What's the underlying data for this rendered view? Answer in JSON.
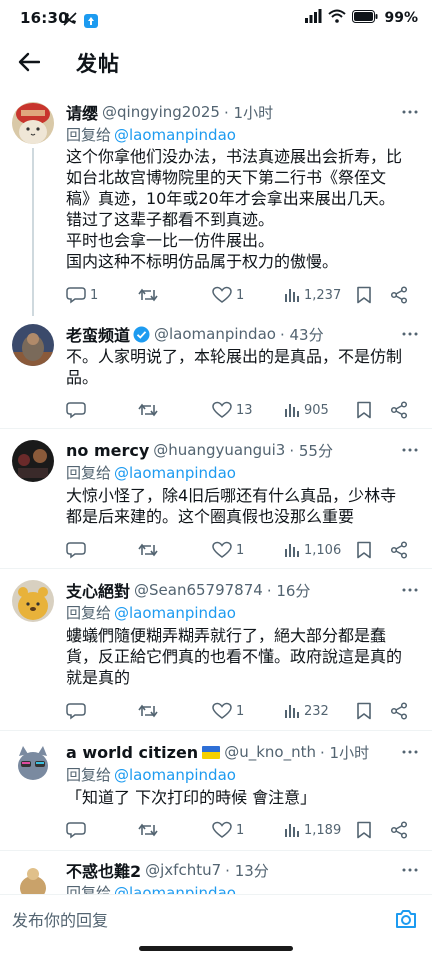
{
  "status_bar": {
    "time": "16:30",
    "battery": "99%"
  },
  "header": {
    "title": "发帖"
  },
  "replies": [
    {
      "name": "请缨",
      "handle": "@qingying2025",
      "time": "· 1小时",
      "reply_label": "回复给",
      "mention": "@laomanpindao",
      "lines": [
        "这个你拿他们没办法，书法真迹展出会折寿，比",
        "如台北故宫博物院里的天下第二行书《祭侄文",
        "稿》真迹，10年或20年才会拿出来展出几天。",
        "错过了这辈子都看不到真迹。",
        "平时也会拿一比一仿件展出。",
        "国内这种不标明仿品属于权力的傲慢。"
      ],
      "replies_count": "1",
      "retweets_count": "",
      "likes_count": "1",
      "views_count": "1,237"
    },
    {
      "name": "老蛮频道",
      "handle": "@laomanpindao",
      "time": "· 43分",
      "reply_label": "",
      "mention": "",
      "lines": [
        "不。人家明说了，本轮展出的是真品，不是仿制",
        "品。"
      ],
      "replies_count": "",
      "retweets_count": "",
      "likes_count": "13",
      "views_count": "905"
    },
    {
      "name": "no mercy",
      "handle": "@huangyuangui3",
      "time": "· 55分",
      "reply_label": "回复给",
      "mention": "@laomanpindao",
      "lines": [
        "大惊小怪了，除4旧后哪还有什么真品，少林寺",
        "都是后来建的。这个圈真假也没那么重要"
      ],
      "replies_count": "",
      "retweets_count": "",
      "likes_count": "1",
      "views_count": "1,106"
    },
    {
      "name": "支心絕對",
      "handle": "@Sean65797874",
      "time": "· 16分",
      "reply_label": "回复给",
      "mention": "@laomanpindao",
      "lines": [
        "螻蟻們隨便糊弄糊弄就行了，絕大部分都是蠢",
        "貨，反正給它們真的也看不懂。政府說這是真的",
        "就是真的"
      ],
      "replies_count": "",
      "retweets_count": "",
      "likes_count": "1",
      "views_count": "232"
    },
    {
      "name": "a world citizen",
      "handle": "@u_kno_nth",
      "time": "· 1小时",
      "reply_label": "回复给",
      "mention": "@laomanpindao",
      "lines": [
        "「知道了 下次打印的時候 會注意」"
      ],
      "replies_count": "",
      "retweets_count": "",
      "likes_count": "1",
      "views_count": "1,189"
    },
    {
      "name": "不惑也難2",
      "handle": "@jxfchtu7",
      "time": "· 13分",
      "reply_label": "回复给",
      "mention": "@laomanpindao",
      "lines": [],
      "replies_count": "",
      "retweets_count": "",
      "likes_count": "",
      "views_count": ""
    }
  ],
  "compose": {
    "placeholder": "发布你的回复"
  },
  "colors": {
    "accent": "#1d9bf0",
    "secondary_text": "#536471",
    "primary_text": "#0f1419"
  }
}
